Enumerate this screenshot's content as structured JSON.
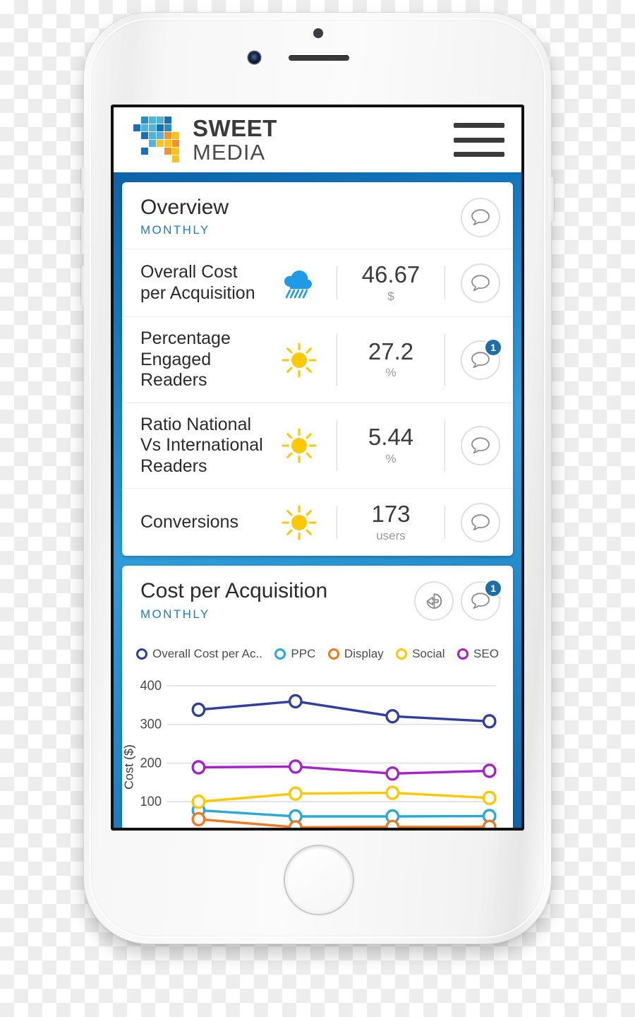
{
  "app": {
    "brand_top": "SWEET",
    "brand_bottom": "MEDIA",
    "menu_icon": "hamburger-icon"
  },
  "overview_card": {
    "title": "Overview",
    "subtitle": "MONTHLY",
    "comment_icon": "speech-bubble-icon",
    "metrics": [
      {
        "label": "Overall Cost per Acquisition",
        "icon": "rain-cloud-icon",
        "value": "46.67",
        "unit": "$",
        "badge": ""
      },
      {
        "label": "Percentage Engaged Readers",
        "icon": "sun-icon",
        "value": "27.2",
        "unit": "%",
        "badge": "1"
      },
      {
        "label": "Ratio National Vs International Readers",
        "icon": "sun-icon",
        "value": "5.44",
        "unit": "%",
        "badge": ""
      },
      {
        "label": "Conversions",
        "icon": "sun-icon",
        "value": "173",
        "unit": "users",
        "badge": ""
      }
    ]
  },
  "chart_card": {
    "title": "Cost per Acquisition",
    "subtitle": "MONTHLY",
    "drill_icon": "pie-arrow-icon",
    "comment_icon": "speech-bubble-icon",
    "comment_badge": "1"
  },
  "colors": {
    "brand_blue": "#1d7bc4",
    "badge_blue": "#1e6fa8",
    "sun_yellow": "#fcc800",
    "rain_blue": "#1e9ae8",
    "series_overall": "#2e3f9e",
    "series_ppc": "#2aa9d8",
    "series_display": "#f0781e",
    "series_social": "#fcc800",
    "series_seo": "#a521c9"
  },
  "chart_data": {
    "type": "line",
    "title": "Cost per Acquisition",
    "subtitle": "MONTHLY",
    "xlabel": "",
    "ylabel": "Cost ($)",
    "ylim": [
      0,
      420
    ],
    "yticks": [
      100,
      200,
      300,
      400
    ],
    "grid": true,
    "legend_position": "top",
    "x": [
      1,
      2,
      3,
      4
    ],
    "series": [
      {
        "name": "Overall Cost per Ac..",
        "color": "#2e3f9e",
        "values": [
          338,
          360,
          321,
          308
        ]
      },
      {
        "name": "PPC",
        "color": "#2aa9d8",
        "values": [
          78,
          62,
          62,
          63
        ]
      },
      {
        "name": "Display",
        "color": "#f0781e",
        "values": [
          55,
          34,
          35,
          35
        ]
      },
      {
        "name": "Social",
        "color": "#fcc800",
        "values": [
          100,
          121,
          123,
          110
        ]
      },
      {
        "name": "SEO",
        "color": "#a521c9",
        "values": [
          189,
          191,
          173,
          180
        ]
      }
    ]
  }
}
